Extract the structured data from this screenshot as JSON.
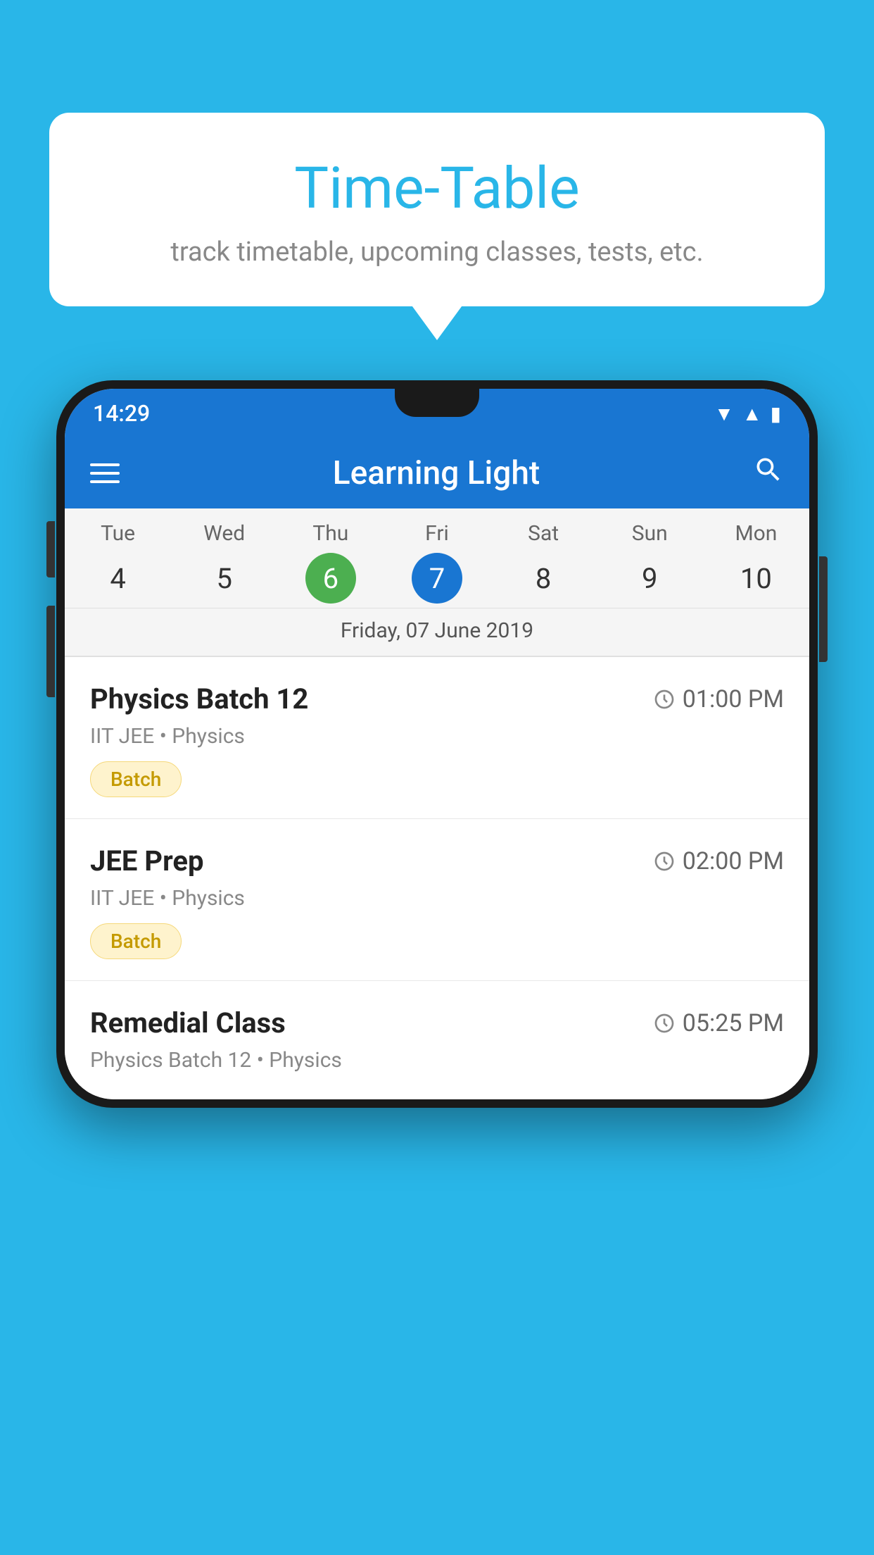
{
  "background_color": "#29b6e8",
  "speech_bubble": {
    "title": "Time-Table",
    "subtitle": "track timetable, upcoming classes, tests, etc."
  },
  "phone": {
    "status_bar": {
      "time": "14:29"
    },
    "toolbar": {
      "title": "Learning Light",
      "menu_icon": "menu",
      "search_icon": "search"
    },
    "calendar": {
      "days": [
        {
          "name": "Tue",
          "num": "4",
          "state": "normal"
        },
        {
          "name": "Wed",
          "num": "5",
          "state": "normal"
        },
        {
          "name": "Thu",
          "num": "6",
          "state": "today"
        },
        {
          "name": "Fri",
          "num": "7",
          "state": "selected"
        },
        {
          "name": "Sat",
          "num": "8",
          "state": "normal"
        },
        {
          "name": "Sun",
          "num": "9",
          "state": "normal"
        },
        {
          "name": "Mon",
          "num": "10",
          "state": "normal"
        }
      ],
      "selected_date_label": "Friday, 07 June 2019"
    },
    "classes": [
      {
        "name": "Physics Batch 12",
        "time": "01:00 PM",
        "detail": "IIT JEE • Physics",
        "badge": "Batch"
      },
      {
        "name": "JEE Prep",
        "time": "02:00 PM",
        "detail": "IIT JEE • Physics",
        "badge": "Batch"
      },
      {
        "name": "Remedial Class",
        "time": "05:25 PM",
        "detail": "Physics Batch 12 • Physics",
        "badge": null
      }
    ]
  }
}
